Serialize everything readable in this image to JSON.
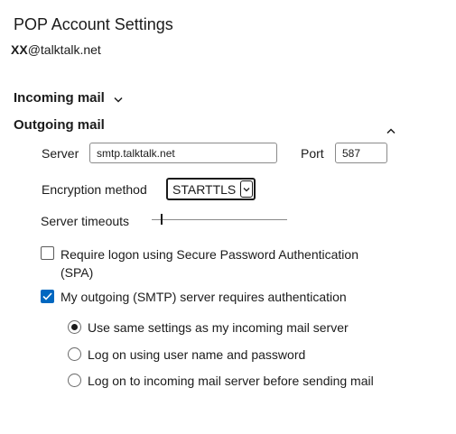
{
  "header": {
    "title": "POP Account Settings",
    "account_redacted": "XX",
    "account_domain": "@talktalk.net"
  },
  "incoming": {
    "label": "Incoming mail",
    "icon": "chevron-down-icon"
  },
  "outgoing": {
    "label": "Outgoing mail",
    "icon": "chevron-up-icon",
    "server_label": "Server",
    "server_value": "smtp.talktalk.net",
    "port_label": "Port",
    "port_value": "587",
    "encryption_label": "Encryption method",
    "encryption_value": "STARTTLS",
    "timeouts_label": "Server timeouts",
    "timeouts_level": 0.07,
    "spa": {
      "label_line1": "Require logon using Secure Password Authentication",
      "label_line2": "(SPA)",
      "checked": false
    },
    "auth": {
      "label": "My outgoing (SMTP) server requires authentication",
      "checked": true
    },
    "auth_options": [
      {
        "label": "Use same settings as my incoming mail server",
        "selected": true
      },
      {
        "label": "Log on using user name and password",
        "selected": false
      },
      {
        "label": "Log on to incoming mail server before sending mail",
        "selected": false
      }
    ]
  },
  "colors": {
    "accent": "#0067c0",
    "text": "#1b1b1b"
  }
}
